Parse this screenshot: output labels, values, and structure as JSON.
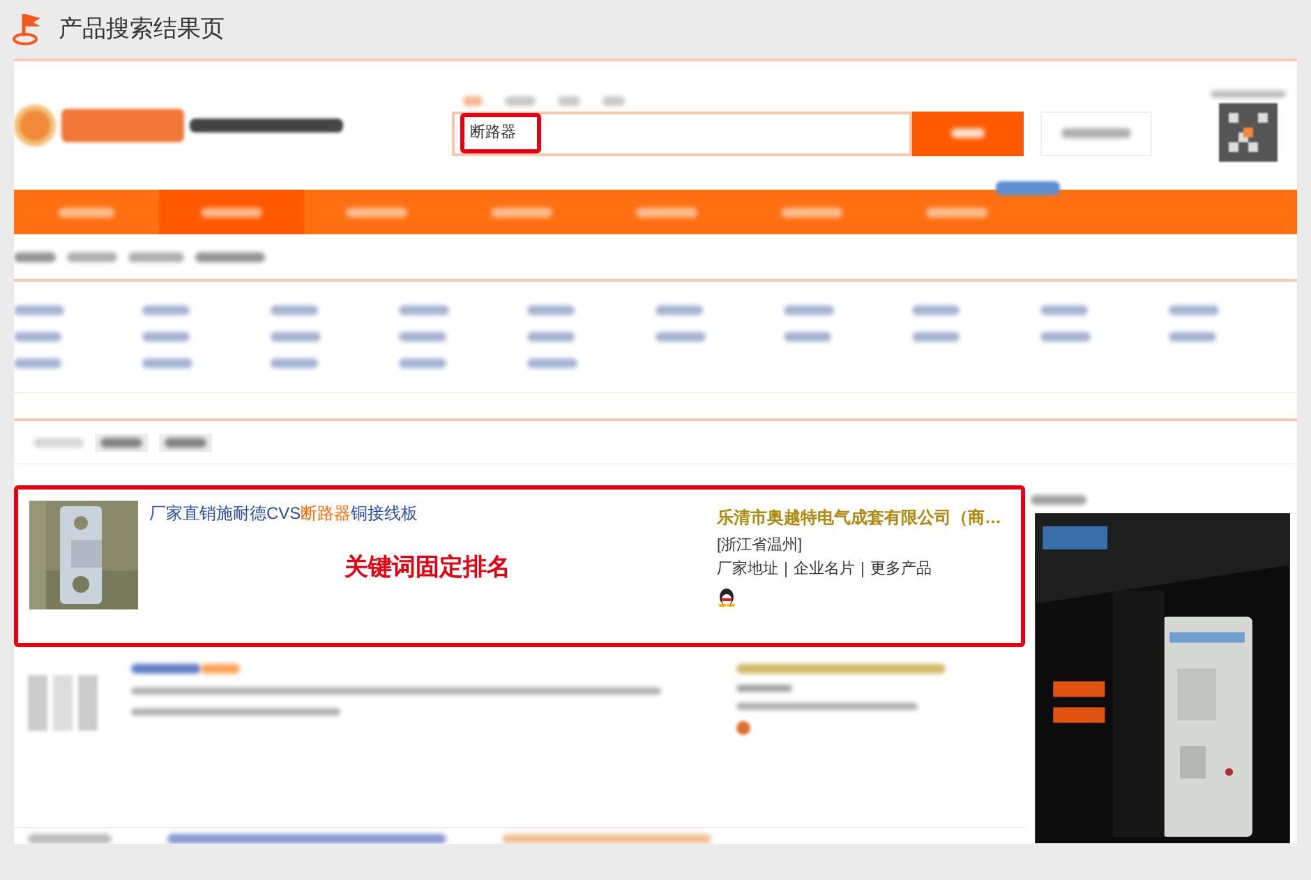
{
  "page": {
    "title": "产品搜索结果页"
  },
  "search": {
    "value": "断路器"
  },
  "featured": {
    "title": [
      {
        "text": "厂家直销施耐德CVS",
        "highlight": false
      },
      {
        "text": "断路器",
        "highlight": true
      },
      {
        "text": "铜接线板",
        "highlight": false
      }
    ],
    "company": "乐清市奥越特电气成套有限公司（商…",
    "location": "[浙江省温州]",
    "links": [
      "厂家地址",
      "企业名片",
      "更多产品"
    ],
    "annotation": "关键词固定排名"
  }
}
